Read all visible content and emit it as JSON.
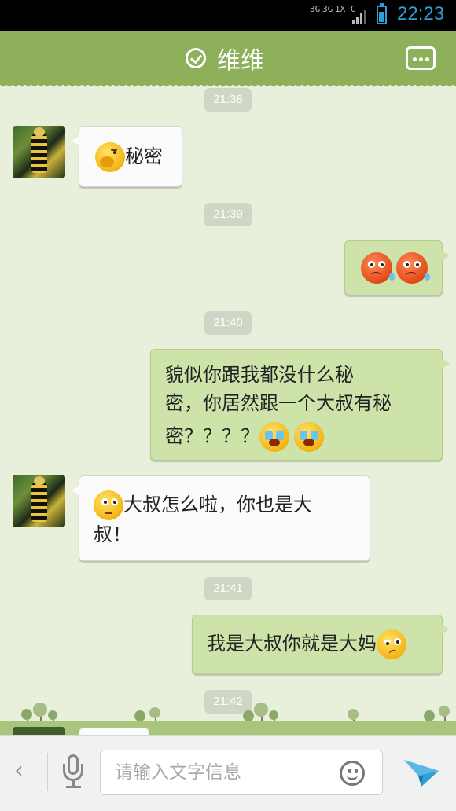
{
  "status_bar": {
    "network_1": "3G",
    "network_2": "3G",
    "network_3": "1X",
    "network_4": "G",
    "time": "22:23"
  },
  "header": {
    "title": "维维"
  },
  "messages": [
    {
      "type": "timestamp",
      "text": "21:38"
    },
    {
      "type": "received",
      "text": "秘密",
      "emoji": "hush-emoji"
    },
    {
      "type": "timestamp",
      "text": "21:39"
    },
    {
      "type": "sent",
      "text": "",
      "emoji": "sad-red-emoji x2"
    },
    {
      "type": "timestamp",
      "text": "21:40"
    },
    {
      "type": "sent",
      "line1": "貌似你跟我都没什么秘",
      "line2": "密，你居然跟一个大叔有秘",
      "line3": "密？？？？",
      "emoji": "crying-emoji x2"
    },
    {
      "type": "received",
      "line1": "大叔怎么啦，你也是大",
      "line2": "叔！",
      "emoji": "thinking-emoji"
    },
    {
      "type": "timestamp",
      "text": "21:41"
    },
    {
      "type": "sent",
      "text": "我是大叔你就是大妈",
      "emoji": "smirk-emoji"
    },
    {
      "type": "timestamp",
      "text": "21:42"
    }
  ],
  "input_bar": {
    "placeholder": "请输入文字信息",
    "value": ""
  },
  "colors": {
    "header": "#8fb05a",
    "sent_bubble": "#cde3a9",
    "received_bubble": "#fbfbfb",
    "background": "#e8f0dc",
    "accent_blue": "#2f9fd6"
  }
}
